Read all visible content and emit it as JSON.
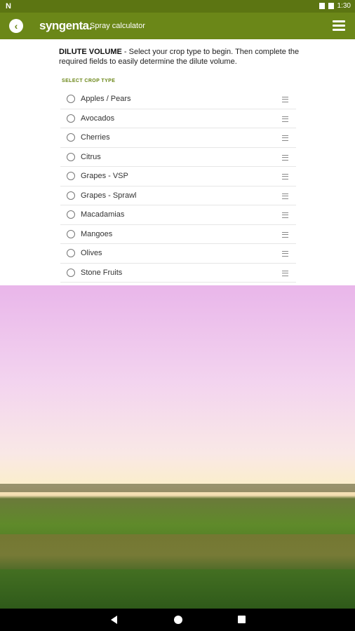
{
  "status_bar": {
    "left_glyph": "N",
    "time": "1:30"
  },
  "app_bar": {
    "brand": "syngenta.",
    "subtitle": "Spray calculator",
    "back_icon": "back-arrow-icon",
    "menu_icon": "hamburger-menu-icon",
    "color": "#6b8718"
  },
  "intro": {
    "heading": "DILUTE VOLUME",
    "text": " - Select your crop type to begin. Then complete the required fields to easily determine the dilute volume."
  },
  "section_label": "SELECT CROP TYPE",
  "crops": [
    {
      "label": "Apples / Pears",
      "icon": "apple-icon"
    },
    {
      "label": "Avocados",
      "icon": "avocado-icon"
    },
    {
      "label": "Cherries",
      "icon": "cherry-icon"
    },
    {
      "label": "Citrus",
      "icon": "citrus-icon"
    },
    {
      "label": "Grapes - VSP",
      "icon": "grape-icon"
    },
    {
      "label": "Grapes - Sprawl",
      "icon": "grape-icon"
    },
    {
      "label": "Macadamias",
      "icon": "macadamia-icon"
    },
    {
      "label": "Mangoes",
      "icon": "mango-icon"
    },
    {
      "label": "Olives",
      "icon": "olive-icon"
    },
    {
      "label": "Stone Fruits",
      "icon": "stone-fruit-icon"
    }
  ]
}
